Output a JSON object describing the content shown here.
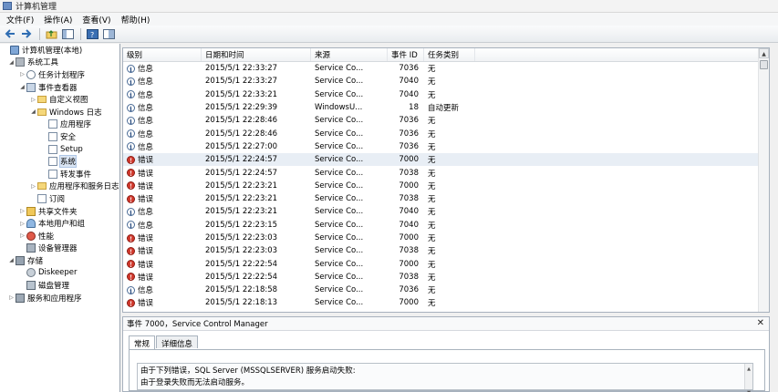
{
  "window": {
    "title": "计算机管理"
  },
  "menu": [
    "文件(F)",
    "操作(A)",
    "查看(V)",
    "帮助(H)"
  ],
  "toolbar": [
    {
      "icon": "back-arrow-icon"
    },
    {
      "icon": "forward-arrow-icon"
    },
    {
      "icon": "up-folder-icon"
    },
    {
      "icon": "show-hide-tree-icon"
    },
    {
      "icon": "help-icon"
    },
    {
      "icon": "properties-icon"
    }
  ],
  "tree": [
    {
      "label": "计算机管理(本地)",
      "indent": 0,
      "exp": "",
      "icon": "computer"
    },
    {
      "label": "系统工具",
      "indent": 1,
      "exp": "◢",
      "icon": "tools"
    },
    {
      "label": "任务计划程序",
      "indent": 2,
      "exp": "▷",
      "icon": "clock"
    },
    {
      "label": "事件查看器",
      "indent": 2,
      "exp": "◢",
      "icon": "event"
    },
    {
      "label": "自定义视图",
      "indent": 3,
      "exp": "▷",
      "icon": "folder"
    },
    {
      "label": "Windows 日志",
      "indent": 3,
      "exp": "◢",
      "icon": "folder"
    },
    {
      "label": "应用程序",
      "indent": 4,
      "exp": "",
      "icon": "log"
    },
    {
      "label": "安全",
      "indent": 4,
      "exp": "",
      "icon": "log"
    },
    {
      "label": "Setup",
      "indent": 4,
      "exp": "",
      "icon": "log"
    },
    {
      "label": "系统",
      "indent": 4,
      "exp": "",
      "icon": "log",
      "selected": true
    },
    {
      "label": "转发事件",
      "indent": 4,
      "exp": "",
      "icon": "log"
    },
    {
      "label": "应用程序和服务日志",
      "indent": 3,
      "exp": "▷",
      "icon": "folder"
    },
    {
      "label": "订阅",
      "indent": 3,
      "exp": "",
      "icon": "log"
    },
    {
      "label": "共享文件夹",
      "indent": 2,
      "exp": "▷",
      "icon": "share"
    },
    {
      "label": "本地用户和组",
      "indent": 2,
      "exp": "▷",
      "icon": "users"
    },
    {
      "label": "性能",
      "indent": 2,
      "exp": "▷",
      "icon": "perf"
    },
    {
      "label": "设备管理器",
      "indent": 2,
      "exp": "",
      "icon": "device"
    },
    {
      "label": "存储",
      "indent": 1,
      "exp": "◢",
      "icon": "storage"
    },
    {
      "label": "Diskeeper",
      "indent": 2,
      "exp": "",
      "icon": "disk"
    },
    {
      "label": "磁盘管理",
      "indent": 2,
      "exp": "",
      "icon": "disk-mgmt"
    },
    {
      "label": "服务和应用程序",
      "indent": 1,
      "exp": "▷",
      "icon": "services"
    }
  ],
  "columns": [
    "级别",
    "日期和时间",
    "来源",
    "事件 ID",
    "任务类别"
  ],
  "events": [
    {
      "level": "信息",
      "type": "info",
      "date": "2015/5/1 22:33:27",
      "source": "Service Co...",
      "id": "7036",
      "task": "无"
    },
    {
      "level": "信息",
      "type": "info",
      "date": "2015/5/1 22:33:27",
      "source": "Service Co...",
      "id": "7040",
      "task": "无"
    },
    {
      "level": "信息",
      "type": "info",
      "date": "2015/5/1 22:33:21",
      "source": "Service Co...",
      "id": "7040",
      "task": "无"
    },
    {
      "level": "信息",
      "type": "info",
      "date": "2015/5/1 22:29:39",
      "source": "WindowsU...",
      "id": "18",
      "task": "自动更新"
    },
    {
      "level": "信息",
      "type": "info",
      "date": "2015/5/1 22:28:46",
      "source": "Service Co...",
      "id": "7036",
      "task": "无"
    },
    {
      "level": "信息",
      "type": "info",
      "date": "2015/5/1 22:28:46",
      "source": "Service Co...",
      "id": "7036",
      "task": "无"
    },
    {
      "level": "信息",
      "type": "info",
      "date": "2015/5/1 22:27:00",
      "source": "Service Co...",
      "id": "7036",
      "task": "无"
    },
    {
      "level": "错误",
      "type": "error",
      "date": "2015/5/1 22:24:57",
      "source": "Service Co...",
      "id": "7000",
      "task": "无",
      "selected": true
    },
    {
      "level": "错误",
      "type": "error",
      "date": "2015/5/1 22:24:57",
      "source": "Service Co...",
      "id": "7038",
      "task": "无"
    },
    {
      "level": "错误",
      "type": "error",
      "date": "2015/5/1 22:23:21",
      "source": "Service Co...",
      "id": "7000",
      "task": "无"
    },
    {
      "level": "错误",
      "type": "error",
      "date": "2015/5/1 22:23:21",
      "source": "Service Co...",
      "id": "7038",
      "task": "无"
    },
    {
      "level": "信息",
      "type": "info",
      "date": "2015/5/1 22:23:21",
      "source": "Service Co...",
      "id": "7040",
      "task": "无"
    },
    {
      "level": "信息",
      "type": "info",
      "date": "2015/5/1 22:23:15",
      "source": "Service Co...",
      "id": "7040",
      "task": "无"
    },
    {
      "level": "错误",
      "type": "error",
      "date": "2015/5/1 22:23:03",
      "source": "Service Co...",
      "id": "7000",
      "task": "无"
    },
    {
      "level": "错误",
      "type": "error",
      "date": "2015/5/1 22:23:03",
      "source": "Service Co...",
      "id": "7038",
      "task": "无"
    },
    {
      "level": "错误",
      "type": "error",
      "date": "2015/5/1 22:22:54",
      "source": "Service Co...",
      "id": "7000",
      "task": "无"
    },
    {
      "level": "错误",
      "type": "error",
      "date": "2015/5/1 22:22:54",
      "source": "Service Co...",
      "id": "7038",
      "task": "无"
    },
    {
      "level": "信息",
      "type": "info",
      "date": "2015/5/1 22:18:58",
      "source": "Service Co...",
      "id": "7036",
      "task": "无"
    },
    {
      "level": "错误",
      "type": "error",
      "date": "2015/5/1 22:18:13",
      "source": "Service Co...",
      "id": "7000",
      "task": "无"
    }
  ],
  "detail": {
    "title": "事件 7000，Service Control Manager",
    "tabs": [
      "常规",
      "详细信息"
    ],
    "description_lines": [
      "由于下列错误，SQL Server (MSSQLSERVER) 服务启动失败:",
      "由于登录失败而无法启动服务。"
    ]
  }
}
